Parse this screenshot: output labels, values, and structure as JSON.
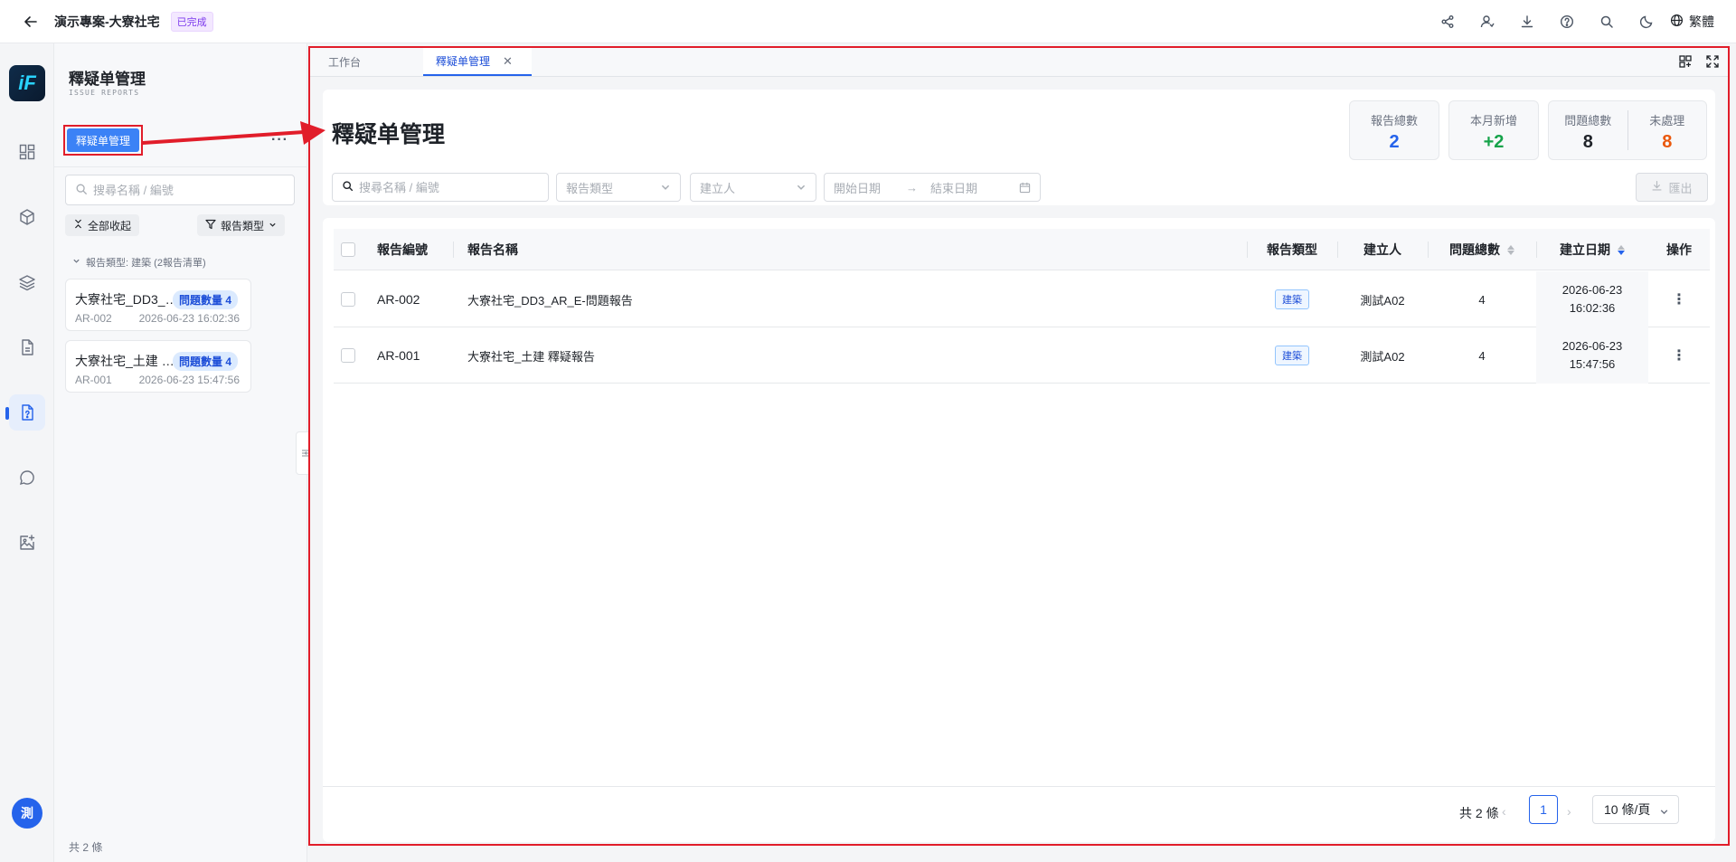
{
  "header": {
    "project_title": "演示專案-大寮社宅",
    "status": "已完成",
    "language": "繁體"
  },
  "rail": {
    "logo_text": "iF",
    "avatar_text": "測"
  },
  "side": {
    "title": "釋疑单管理",
    "subtitle": "ISSUE REPORTS",
    "primary_button": "释疑单管理",
    "more": "···",
    "search_placeholder": "搜尋名稱 / 編號",
    "collapse_all": "全部收起",
    "type_filter": "報告類型",
    "group_label": "報告類型: 建築 (2報告清單)",
    "cards": [
      {
        "name": "大寮社宅_DD3_AR_E...",
        "badge": "問題數量 4",
        "code": "AR-002",
        "date": "2026-06-23 16:02:36"
      },
      {
        "name": "大寮社宅_土建 釋疑...",
        "badge": "問題數量 4",
        "code": "AR-001",
        "date": "2026-06-23 15:47:56"
      }
    ],
    "footer": "共 2 條"
  },
  "tabs": [
    {
      "label": "工作台"
    },
    {
      "label": "釋疑单管理"
    }
  ],
  "main": {
    "title": "釋疑单管理",
    "stats": {
      "total_label": "報告總數",
      "total_value": "2",
      "month_label": "本月新增",
      "month_value": "+2",
      "issues_label": "問題總數",
      "issues_value": "8",
      "pending_label": "未處理",
      "pending_value": "8"
    },
    "filters": {
      "search_placeholder": "搜尋名稱 / 編號",
      "type_placeholder": "報告類型",
      "creator_placeholder": "建立人",
      "start_date": "開始日期",
      "end_date": "結束日期",
      "export": "匯出"
    },
    "colors": {
      "total": "#2563eb",
      "month": "#16a34a",
      "issues": "#1f2329",
      "pending": "#ea580c"
    }
  },
  "table": {
    "columns": [
      "報告編號",
      "報告名稱",
      "報告類型",
      "建立人",
      "問題總數",
      "建立日期",
      "操作"
    ],
    "rows": [
      {
        "code": "AR-002",
        "name": "大寮社宅_DD3_AR_E-問題報告",
        "type": "建築",
        "creator": "測試A02",
        "count": "4",
        "date": "2026-06-23",
        "time": "16:02:36"
      },
      {
        "code": "AR-001",
        "name": "大寮社宅_土建 釋疑報告",
        "type": "建築",
        "creator": "測試A02",
        "count": "4",
        "date": "2026-06-23",
        "time": "15:47:56"
      }
    ]
  },
  "pager": {
    "total": "共 2 條",
    "page": "1",
    "size": "10 條/頁"
  }
}
